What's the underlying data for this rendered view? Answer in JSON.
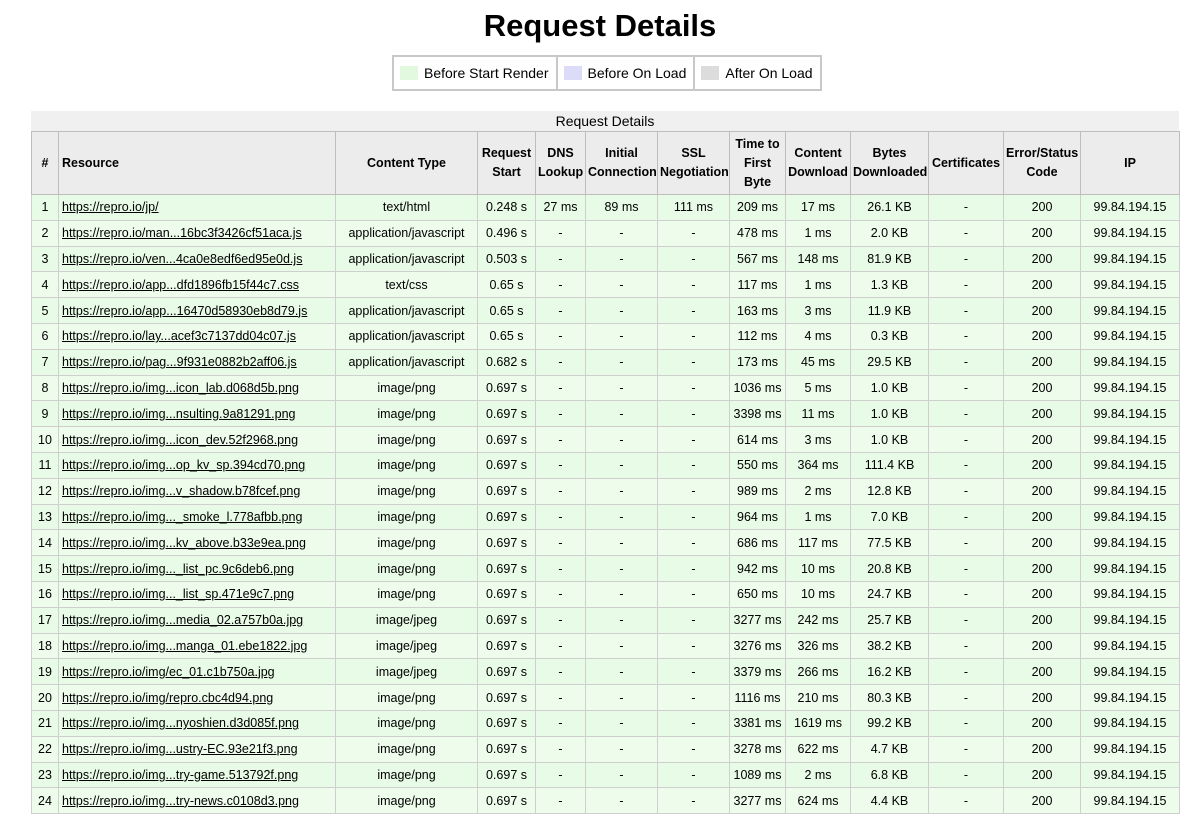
{
  "page_title": "Request Details",
  "legend": [
    {
      "label": "Before Start Render",
      "color": "#e2f9df"
    },
    {
      "label": "Before On Load",
      "color": "#dcdcf8"
    },
    {
      "label": "After On Load",
      "color": "#dcdcdc"
    }
  ],
  "table": {
    "caption": "Request Details",
    "headers": {
      "num": "#",
      "resource": "Resource",
      "content_type": "Content Type",
      "request_start": "Request Start",
      "dns": "DNS Lookup",
      "initial_connection": "Initial Connection",
      "ssl": "SSL Negotiation",
      "ttfb": "Time to First Byte",
      "content_download": "Content Download",
      "bytes": "Bytes Downloaded",
      "certificates": "Certificates",
      "status": "Error/Status Code",
      "ip": "IP"
    },
    "rows": [
      {
        "num": "1",
        "resource": "https://repro.io/jp/",
        "content_type": "text/html",
        "request_start": "0.248 s",
        "dns": "27 ms",
        "initial_connection": "89 ms",
        "ssl": "111 ms",
        "ttfb": "209 ms",
        "content_download": "17 ms",
        "bytes": "26.1 KB",
        "certificates": "-",
        "status": "200",
        "ip": "99.84.194.15"
      },
      {
        "num": "2",
        "resource": "https://repro.io/man...16bc3f3426cf51aca.js",
        "content_type": "application/javascript",
        "request_start": "0.496 s",
        "dns": "-",
        "initial_connection": "-",
        "ssl": "-",
        "ttfb": "478 ms",
        "content_download": "1 ms",
        "bytes": "2.0 KB",
        "certificates": "-",
        "status": "200",
        "ip": "99.84.194.15"
      },
      {
        "num": "3",
        "resource": "https://repro.io/ven...4ca0e8edf6ed95e0d.js",
        "content_type": "application/javascript",
        "request_start": "0.503 s",
        "dns": "-",
        "initial_connection": "-",
        "ssl": "-",
        "ttfb": "567 ms",
        "content_download": "148 ms",
        "bytes": "81.9 KB",
        "certificates": "-",
        "status": "200",
        "ip": "99.84.194.15"
      },
      {
        "num": "4",
        "resource": "https://repro.io/app...dfd1896fb15f44c7.css",
        "content_type": "text/css",
        "request_start": "0.65 s",
        "dns": "-",
        "initial_connection": "-",
        "ssl": "-",
        "ttfb": "117 ms",
        "content_download": "1 ms",
        "bytes": "1.3 KB",
        "certificates": "-",
        "status": "200",
        "ip": "99.84.194.15"
      },
      {
        "num": "5",
        "resource": "https://repro.io/app...16470d58930eb8d79.js",
        "content_type": "application/javascript",
        "request_start": "0.65 s",
        "dns": "-",
        "initial_connection": "-",
        "ssl": "-",
        "ttfb": "163 ms",
        "content_download": "3 ms",
        "bytes": "11.9 KB",
        "certificates": "-",
        "status": "200",
        "ip": "99.84.194.15"
      },
      {
        "num": "6",
        "resource": "https://repro.io/lay...acef3c7137dd04c07.js",
        "content_type": "application/javascript",
        "request_start": "0.65 s",
        "dns": "-",
        "initial_connection": "-",
        "ssl": "-",
        "ttfb": "112 ms",
        "content_download": "4 ms",
        "bytes": "0.3 KB",
        "certificates": "-",
        "status": "200",
        "ip": "99.84.194.15"
      },
      {
        "num": "7",
        "resource": "https://repro.io/pag...9f931e0882b2aff06.js",
        "content_type": "application/javascript",
        "request_start": "0.682 s",
        "dns": "-",
        "initial_connection": "-",
        "ssl": "-",
        "ttfb": "173 ms",
        "content_download": "45 ms",
        "bytes": "29.5 KB",
        "certificates": "-",
        "status": "200",
        "ip": "99.84.194.15"
      },
      {
        "num": "8",
        "resource": "https://repro.io/img...icon_lab.d068d5b.png",
        "content_type": "image/png",
        "request_start": "0.697 s",
        "dns": "-",
        "initial_connection": "-",
        "ssl": "-",
        "ttfb": "1036 ms",
        "content_download": "5 ms",
        "bytes": "1.0 KB",
        "certificates": "-",
        "status": "200",
        "ip": "99.84.194.15"
      },
      {
        "num": "9",
        "resource": "https://repro.io/img...nsulting.9a81291.png",
        "content_type": "image/png",
        "request_start": "0.697 s",
        "dns": "-",
        "initial_connection": "-",
        "ssl": "-",
        "ttfb": "3398 ms",
        "content_download": "11 ms",
        "bytes": "1.0 KB",
        "certificates": "-",
        "status": "200",
        "ip": "99.84.194.15"
      },
      {
        "num": "10",
        "resource": "https://repro.io/img...icon_dev.52f2968.png",
        "content_type": "image/png",
        "request_start": "0.697 s",
        "dns": "-",
        "initial_connection": "-",
        "ssl": "-",
        "ttfb": "614 ms",
        "content_download": "3 ms",
        "bytes": "1.0 KB",
        "certificates": "-",
        "status": "200",
        "ip": "99.84.194.15"
      },
      {
        "num": "11",
        "resource": "https://repro.io/img...op_kv_sp.394cd70.png",
        "content_type": "image/png",
        "request_start": "0.697 s",
        "dns": "-",
        "initial_connection": "-",
        "ssl": "-",
        "ttfb": "550 ms",
        "content_download": "364 ms",
        "bytes": "111.4 KB",
        "certificates": "-",
        "status": "200",
        "ip": "99.84.194.15"
      },
      {
        "num": "12",
        "resource": "https://repro.io/img...v_shadow.b78fcef.png",
        "content_type": "image/png",
        "request_start": "0.697 s",
        "dns": "-",
        "initial_connection": "-",
        "ssl": "-",
        "ttfb": "989 ms",
        "content_download": "2 ms",
        "bytes": "12.8 KB",
        "certificates": "-",
        "status": "200",
        "ip": "99.84.194.15"
      },
      {
        "num": "13",
        "resource": "https://repro.io/img..._smoke_l.778afbb.png",
        "content_type": "image/png",
        "request_start": "0.697 s",
        "dns": "-",
        "initial_connection": "-",
        "ssl": "-",
        "ttfb": "964 ms",
        "content_download": "1 ms",
        "bytes": "7.0 KB",
        "certificates": "-",
        "status": "200",
        "ip": "99.84.194.15"
      },
      {
        "num": "14",
        "resource": "https://repro.io/img...kv_above.b33e9ea.png",
        "content_type": "image/png",
        "request_start": "0.697 s",
        "dns": "-",
        "initial_connection": "-",
        "ssl": "-",
        "ttfb": "686 ms",
        "content_download": "117 ms",
        "bytes": "77.5 KB",
        "certificates": "-",
        "status": "200",
        "ip": "99.84.194.15"
      },
      {
        "num": "15",
        "resource": "https://repro.io/img..._list_pc.9c6deb6.png",
        "content_type": "image/png",
        "request_start": "0.697 s",
        "dns": "-",
        "initial_connection": "-",
        "ssl": "-",
        "ttfb": "942 ms",
        "content_download": "10 ms",
        "bytes": "20.8 KB",
        "certificates": "-",
        "status": "200",
        "ip": "99.84.194.15"
      },
      {
        "num": "16",
        "resource": "https://repro.io/img..._list_sp.471e9c7.png",
        "content_type": "image/png",
        "request_start": "0.697 s",
        "dns": "-",
        "initial_connection": "-",
        "ssl": "-",
        "ttfb": "650 ms",
        "content_download": "10 ms",
        "bytes": "24.7 KB",
        "certificates": "-",
        "status": "200",
        "ip": "99.84.194.15"
      },
      {
        "num": "17",
        "resource": "https://repro.io/img...media_02.a757b0a.jpg",
        "content_type": "image/jpeg",
        "request_start": "0.697 s",
        "dns": "-",
        "initial_connection": "-",
        "ssl": "-",
        "ttfb": "3277 ms",
        "content_download": "242 ms",
        "bytes": "25.7 KB",
        "certificates": "-",
        "status": "200",
        "ip": "99.84.194.15"
      },
      {
        "num": "18",
        "resource": "https://repro.io/img...manga_01.ebe1822.jpg",
        "content_type": "image/jpeg",
        "request_start": "0.697 s",
        "dns": "-",
        "initial_connection": "-",
        "ssl": "-",
        "ttfb": "3276 ms",
        "content_download": "326 ms",
        "bytes": "38.2 KB",
        "certificates": "-",
        "status": "200",
        "ip": "99.84.194.15"
      },
      {
        "num": "19",
        "resource": "https://repro.io/img/ec_01.c1b750a.jpg",
        "content_type": "image/jpeg",
        "request_start": "0.697 s",
        "dns": "-",
        "initial_connection": "-",
        "ssl": "-",
        "ttfb": "3379 ms",
        "content_download": "266 ms",
        "bytes": "16.2 KB",
        "certificates": "-",
        "status": "200",
        "ip": "99.84.194.15"
      },
      {
        "num": "20",
        "resource": "https://repro.io/img/repro.cbc4d94.png",
        "content_type": "image/png",
        "request_start": "0.697 s",
        "dns": "-",
        "initial_connection": "-",
        "ssl": "-",
        "ttfb": "1116 ms",
        "content_download": "210 ms",
        "bytes": "80.3 KB",
        "certificates": "-",
        "status": "200",
        "ip": "99.84.194.15"
      },
      {
        "num": "21",
        "resource": "https://repro.io/img...nyoshien.d3d085f.png",
        "content_type": "image/png",
        "request_start": "0.697 s",
        "dns": "-",
        "initial_connection": "-",
        "ssl": "-",
        "ttfb": "3381 ms",
        "content_download": "1619 ms",
        "bytes": "99.2 KB",
        "certificates": "-",
        "status": "200",
        "ip": "99.84.194.15"
      },
      {
        "num": "22",
        "resource": "https://repro.io/img...ustry-EC.93e21f3.png",
        "content_type": "image/png",
        "request_start": "0.697 s",
        "dns": "-",
        "initial_connection": "-",
        "ssl": "-",
        "ttfb": "3278 ms",
        "content_download": "622 ms",
        "bytes": "4.7 KB",
        "certificates": "-",
        "status": "200",
        "ip": "99.84.194.15"
      },
      {
        "num": "23",
        "resource": "https://repro.io/img...try-game.513792f.png",
        "content_type": "image/png",
        "request_start": "0.697 s",
        "dns": "-",
        "initial_connection": "-",
        "ssl": "-",
        "ttfb": "1089 ms",
        "content_download": "2 ms",
        "bytes": "6.8 KB",
        "certificates": "-",
        "status": "200",
        "ip": "99.84.194.15"
      },
      {
        "num": "24",
        "resource": "https://repro.io/img...try-news.c0108d3.png",
        "content_type": "image/png",
        "request_start": "0.697 s",
        "dns": "-",
        "initial_connection": "-",
        "ssl": "-",
        "ttfb": "3277 ms",
        "content_download": "624 ms",
        "bytes": "4.4 KB",
        "certificates": "-",
        "status": "200",
        "ip": "99.84.194.15"
      }
    ]
  }
}
